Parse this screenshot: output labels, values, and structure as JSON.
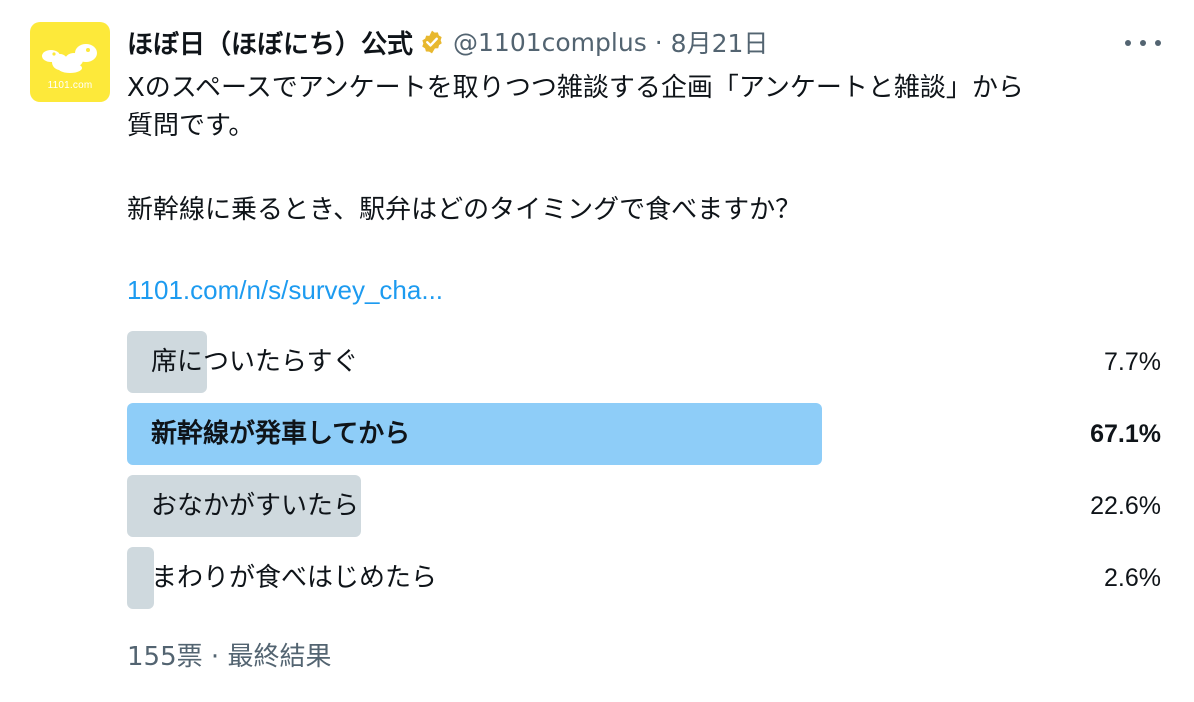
{
  "author": {
    "display_name": "ほぼ日（ほぼにち）公式",
    "handle": "@1101complus",
    "separator": "·",
    "date": "8月21日",
    "avatar_caption": "1101.com",
    "avatar_color": "#fde93a",
    "verified_color": "#e8b82f"
  },
  "tweet": {
    "line1": "Xのスペースでアンケートを取りつつ雑談する企画「アンケートと雑談」から",
    "line2": "質問です。",
    "question": "新幹線に乗るとき、駅弁はどのタイミングで食べますか？",
    "link_text": "1101.com/n/s/survey_cha..."
  },
  "poll": {
    "options": [
      {
        "label": "席についたらすぐ",
        "percent_text": "7.7%",
        "percent": 7.7,
        "winner": false
      },
      {
        "label": "新幹線が発車してから",
        "percent_text": "67.1%",
        "percent": 67.1,
        "winner": true
      },
      {
        "label": "おなかがすいたら",
        "percent_text": "22.6%",
        "percent": 22.6,
        "winner": false
      },
      {
        "label": "まわりが食べはじめたら",
        "percent_text": "2.6%",
        "percent": 2.6,
        "winner": false
      }
    ],
    "votes": "155票",
    "separator": "·",
    "status": "最終結果"
  },
  "colors": {
    "link": "#1d9bf0",
    "bar": "#cfd9de",
    "winner_bar": "#8ecdf8",
    "secondary_text": "#536471"
  },
  "icons": [
    "avatar-logo-icon",
    "verified-badge-icon",
    "more-options-icon"
  ]
}
